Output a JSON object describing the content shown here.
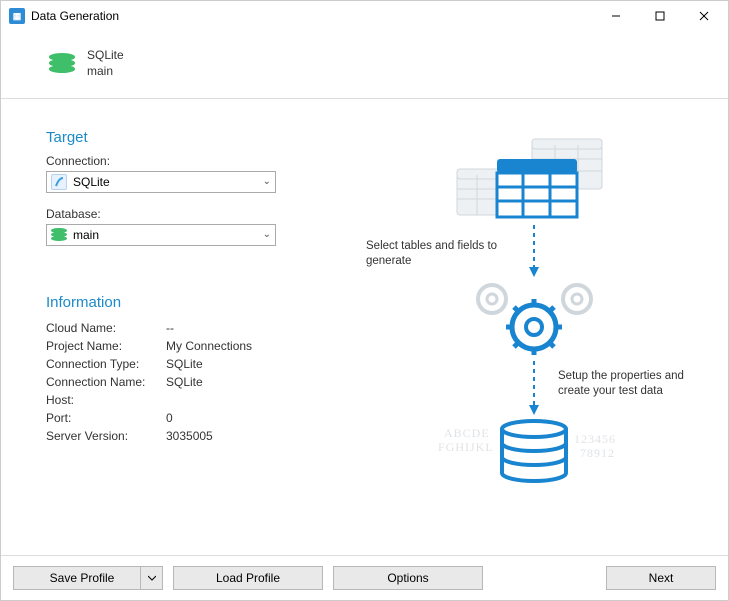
{
  "window": {
    "title": "Data Generation"
  },
  "header": {
    "driver": "SQLite",
    "database": "main"
  },
  "target": {
    "title": "Target",
    "connection_label": "Connection:",
    "connection_value": "SQLite",
    "database_label": "Database:",
    "database_value": "main"
  },
  "info": {
    "title": "Information",
    "rows": [
      {
        "key": "Cloud Name:",
        "val": "--"
      },
      {
        "key": "Project Name:",
        "val": "My Connections"
      },
      {
        "key": "Connection Type:",
        "val": "SQLite"
      },
      {
        "key": "Connection Name:",
        "val": "SQLite"
      },
      {
        "key": "Host:",
        "val": ""
      },
      {
        "key": "Port:",
        "val": "0"
      },
      {
        "key": "Server Version:",
        "val": "3035005"
      }
    ]
  },
  "illustration": {
    "caption1": "Select tables and fields to generate",
    "caption2": "Setup the properties and create your test data"
  },
  "buttons": {
    "save_profile": "Save Profile",
    "load_profile": "Load Profile",
    "options": "Options",
    "next": "Next"
  }
}
